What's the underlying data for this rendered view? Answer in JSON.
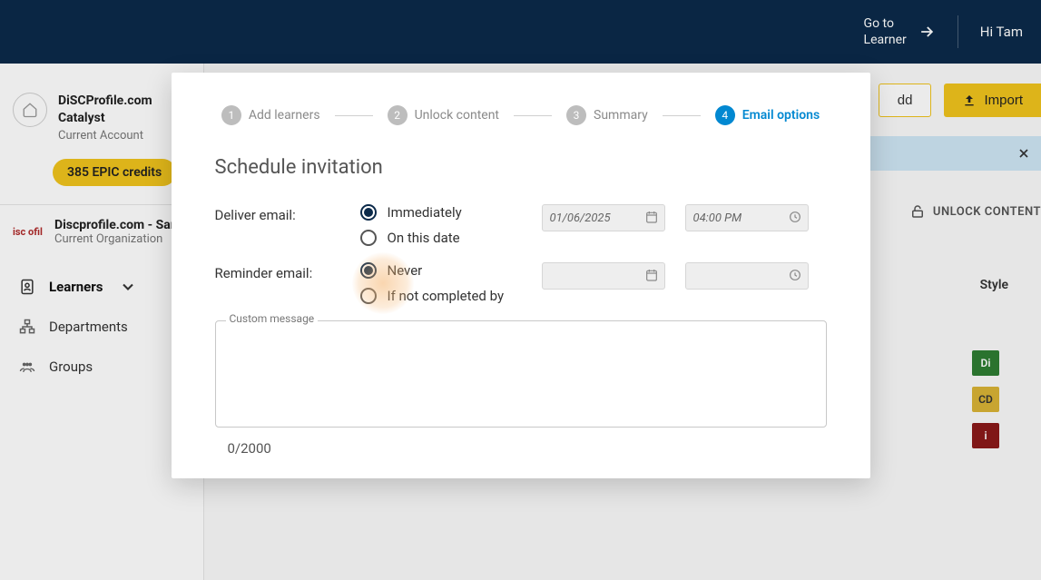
{
  "topnav": {
    "go_to_learner_line1": "Go to",
    "go_to_learner_line2": "Learner",
    "greeting": "Hi Tam"
  },
  "account": {
    "name": "DiSCProfile.com Catalyst",
    "sub": "Current Account",
    "credits": "385 EPIC credits"
  },
  "org": {
    "logo_text": "isc ofil",
    "name": "Discprofile.com - Samp",
    "sub": "Current Organization"
  },
  "sidenav": {
    "learners": "Learners",
    "departments": "Departments",
    "groups": "Groups"
  },
  "main": {
    "add_btn": "dd",
    "import_btn": "Import",
    "unlock": "UNLOCK CONTENT",
    "col_style": "Style",
    "styles": [
      "Di",
      "CD",
      "i"
    ]
  },
  "modal": {
    "steps": [
      {
        "num": "1",
        "label": "Add learners"
      },
      {
        "num": "2",
        "label": "Unlock content"
      },
      {
        "num": "3",
        "label": "Summary"
      },
      {
        "num": "4",
        "label": "Email options"
      }
    ],
    "title": "Schedule invitation",
    "deliver_label": "Deliver email:",
    "deliver_opt1": "Immediately",
    "deliver_opt2": "On this date",
    "deliver_date": "01/06/2025",
    "deliver_time": "04:00 PM",
    "reminder_label": "Reminder email:",
    "reminder_opt1": "Never",
    "reminder_opt2": "If not completed by",
    "custom_label": "Custom message",
    "char_count": "0/2000"
  }
}
